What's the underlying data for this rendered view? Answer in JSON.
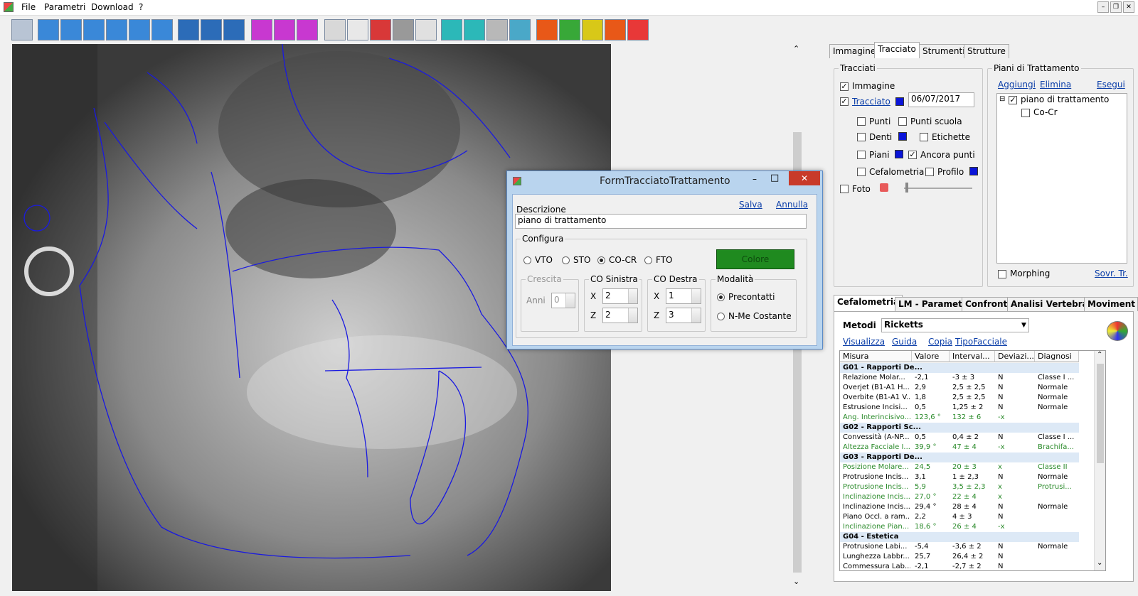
{
  "menu": {
    "file": "File",
    "parametri": "Parametri",
    "download": "Download",
    "help": "?"
  },
  "tabs_right": [
    "Immagine",
    "Tracciato",
    "Strumenti",
    "Strutture"
  ],
  "tracciati": {
    "title": "Tracciati",
    "immagine": "Immagine",
    "tracciato": "Tracciato",
    "date": "06/07/2017",
    "punti": "Punti",
    "punti_scuola": "Punti scuola",
    "denti": "Denti",
    "etichette": "Etichette",
    "piani": "Piani",
    "ancora_punti": "Ancora punti",
    "cefalometria": "Cefalometria",
    "profilo": "Profilo",
    "foto": "Foto"
  },
  "piani": {
    "title": "Piani di Trattamento",
    "aggiungi": "Aggiungi",
    "elimina": "Elimina",
    "esegui": "Esegui",
    "tree_root": "piano di trattamento",
    "tree_child": "Co-Cr",
    "morphing": "Morphing",
    "sovr": "Sovr. Tr.",
    "tree_expander": "⊟"
  },
  "dialog": {
    "title": "FormTracciatoTrattamento",
    "descrizione_label": "Descrizione",
    "salva": "Salva",
    "annulla": "Annulla",
    "descrizione_value": "piano di trattamento",
    "configura": "Configura",
    "vto": "VTO",
    "sto": "STO",
    "cocr": "CO-CR",
    "fto": "FTO",
    "colore": "Colore",
    "crescita": "Crescita",
    "anni": "Anni",
    "anni_value": "0",
    "co_sinistra": "CO Sinistra",
    "co_destra": "CO Destra",
    "x": "X",
    "z": "Z",
    "sx_x": "2",
    "sx_z": "2",
    "dx_x": "1",
    "dx_z": "3",
    "modalita": "Modalità",
    "precontatti": "Precontatti",
    "nme": "N-Me Costante",
    "minimize": "–",
    "maximize": "□",
    "close": "✕"
  },
  "bottom_tabs": [
    "Cefalometria",
    "LM - Parametri",
    "Confronti",
    "Analisi Vertebrale",
    "Moviment"
  ],
  "metodi": {
    "label": "Metodi",
    "value": "Ricketts"
  },
  "links": {
    "visualizza": "Visualizza",
    "guida": "Guida",
    "copia": "Copia",
    "tipo": "TipoFacciale"
  },
  "grid_headers": [
    "Misura",
    "Valore",
    "Interval...",
    "Deviazi...",
    "Diagnosi"
  ],
  "grid_rows": [
    {
      "g": true,
      "m": "G01 - Rapporti De..."
    },
    {
      "m": "Relazione Molar...",
      "v": "-2,1",
      "i": "-3 ± 3",
      "d": "N",
      "dg": "Classe I ..."
    },
    {
      "m": "Overjet (B1-A1 H...",
      "v": "2,9",
      "i": "2,5 ± 2,5",
      "d": "N",
      "dg": "Normale"
    },
    {
      "m": "Overbite (B1-A1 V...",
      "v": "1,8",
      "i": "2,5 ± 2,5",
      "d": "N",
      "dg": "Normale"
    },
    {
      "m": "Estrusione Incisi...",
      "v": "0,5",
      "i": "1,25 ± 2",
      "d": "N",
      "dg": "Normale"
    },
    {
      "m": "Ang. Interincisivo...",
      "v": "123,6 °",
      "i": "132 ± 6",
      "d": "-x",
      "dg": "",
      "green": true
    },
    {
      "g": true,
      "m": "G02 - Rapporti Sc..."
    },
    {
      "m": "Convessità (A-NP...",
      "v": "0,5",
      "i": "0,4 ± 2",
      "d": "N",
      "dg": "Classe I ..."
    },
    {
      "m": "Altezza Facciale I...",
      "v": "39,9 °",
      "i": "47 ± 4",
      "d": "-x",
      "dg": "Brachifa...",
      "green": true
    },
    {
      "g": true,
      "m": "G03 - Rapporti De..."
    },
    {
      "m": "Posizione Molare...",
      "v": "24,5",
      "i": "20 ± 3",
      "d": "x",
      "dg": "Classe II",
      "green": true
    },
    {
      "m": "Protrusione Incis...",
      "v": "3,1",
      "i": "1 ± 2,3",
      "d": "N",
      "dg": "Normale"
    },
    {
      "m": "Protrusione Incis...",
      "v": "5,9",
      "i": "3,5 ± 2,3",
      "d": "x",
      "dg": "Protrusi...",
      "green": true
    },
    {
      "m": "Inclinazione Incis...",
      "v": "27,0 °",
      "i": "22 ± 4",
      "d": "x",
      "dg": "",
      "green": true
    },
    {
      "m": "Inclinazione Incis...",
      "v": "29,4 °",
      "i": "28 ± 4",
      "d": "N",
      "dg": "Normale"
    },
    {
      "m": "Piano Occl. a ram...",
      "v": "2,2",
      "i": "4 ± 3",
      "d": "N",
      "dg": ""
    },
    {
      "m": "Inclinazione Pian...",
      "v": "18,6 °",
      "i": "26 ± 4",
      "d": "-x",
      "dg": "",
      "green": true
    },
    {
      "g": true,
      "m": "G04 - Estetica"
    },
    {
      "m": "Protrusione Labi...",
      "v": "-5,4",
      "i": "-3,6 ± 2",
      "d": "N",
      "dg": "Normale"
    },
    {
      "m": "Lunghezza Labbr...",
      "v": "25,7",
      "i": "26,4 ± 2",
      "d": "N",
      "dg": ""
    },
    {
      "m": "Commessura Lab...",
      "v": "-2,1",
      "i": "-2,7 ± 2",
      "d": "N",
      "dg": ""
    }
  ],
  "colors": {
    "accent": "#0a14d8",
    "dialog_title": "#b9d4ee",
    "colore_btn": "#1f8a1f"
  }
}
